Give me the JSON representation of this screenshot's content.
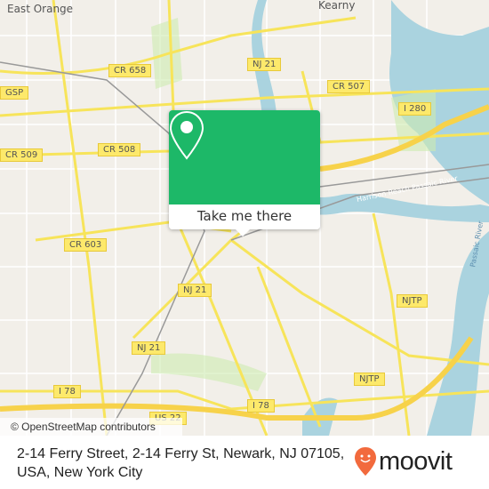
{
  "map": {
    "places": [
      "East Orange",
      "Kearny"
    ],
    "shields": [
      "CR 658",
      "NJ 21",
      "CR 507",
      "I 280",
      "GSP",
      "CR 509",
      "CR 508",
      "CR 603",
      "NJ 21",
      "NJ 21",
      "NJTP",
      "NJTP",
      "I 78",
      "I 78",
      "US 22"
    ],
    "rivers": [
      "Harrison Reach Passaic River",
      "Passaic River"
    ],
    "attribution": "© OpenStreetMap contributors",
    "colors": {
      "land": "#f2efe9",
      "water": "#aad3df",
      "road": "#f7e45a",
      "park": "#cdebb0",
      "accent": "#1db868"
    }
  },
  "popup": {
    "icon": "map-pin-icon",
    "button": "Take me there"
  },
  "footer": {
    "address": "2-14 Ferry Street, 2-14 Ferry St, Newark, NJ 07105, USA, New York City",
    "brand": "moovit",
    "brand_color": "#f26a3d"
  }
}
